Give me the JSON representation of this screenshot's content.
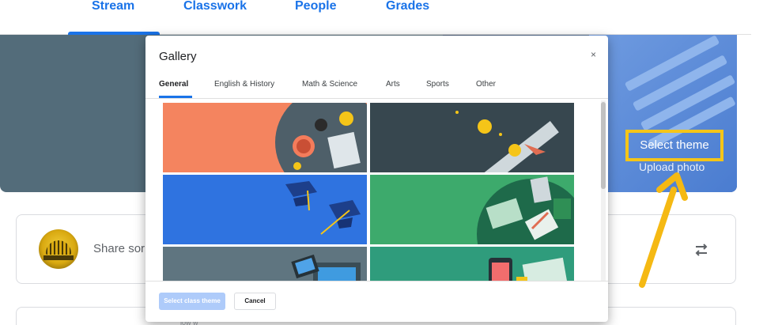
{
  "nav": {
    "tabs": [
      {
        "label": "Stream"
      },
      {
        "label": "Classwork"
      },
      {
        "label": "People"
      },
      {
        "label": "Grades"
      }
    ],
    "accent": "#1a73e8"
  },
  "banner": {
    "select_theme_label": "Select theme",
    "upload_photo_label": "Upload photo",
    "highlight_color": "#f5c518"
  },
  "share": {
    "placeholder": "Share sor"
  },
  "card2": {
    "text": "iow w"
  },
  "dialog": {
    "title": "Gallery",
    "close_glyph": "×",
    "tabs": [
      {
        "label": "General"
      },
      {
        "label": "English & History"
      },
      {
        "label": "Math & Science"
      },
      {
        "label": "Arts"
      },
      {
        "label": "Sports"
      },
      {
        "label": "Other"
      }
    ],
    "active_tab": "General",
    "themes": [
      {
        "name": "theme-tea-books",
        "color": "#f4845f"
      },
      {
        "name": "theme-diploma",
        "color": "#37474f"
      },
      {
        "name": "theme-graduation-caps",
        "color": "#2f73e0"
      },
      {
        "name": "theme-notebooks",
        "color": "#3daa6c"
      },
      {
        "name": "theme-laptop",
        "color": "#5f7580"
      },
      {
        "name": "theme-phone",
        "color": "#2f9c7c"
      }
    ],
    "select_button_label": "Select class theme",
    "cancel_button_label": "Cancel"
  },
  "icons": {
    "close": "close-icon",
    "repost": "repost-icon",
    "arrow": "annotation-arrow"
  }
}
